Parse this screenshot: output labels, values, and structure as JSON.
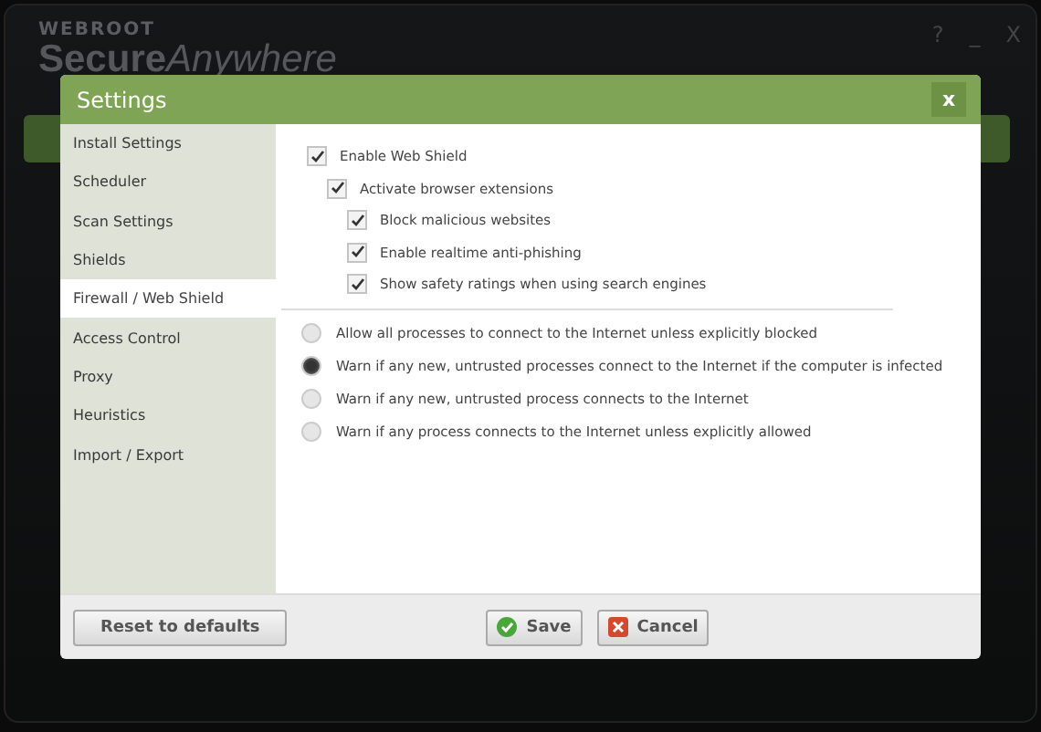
{
  "app": {
    "brand_top": "WEBROOT",
    "brand_main": "Secure",
    "brand_light": "Anywhere",
    "controls": [
      "?",
      "_",
      "X"
    ]
  },
  "dialog": {
    "title": "Settings",
    "close": "x",
    "sidebar": [
      {
        "label": "Install Settings",
        "selected": false
      },
      {
        "label": "Scheduler",
        "selected": false
      },
      {
        "label": "Scan Settings",
        "selected": false
      },
      {
        "label": "Shields",
        "selected": false
      },
      {
        "label": "Firewall / Web Shield",
        "selected": true
      },
      {
        "label": "Access Control",
        "selected": false
      },
      {
        "label": "Proxy",
        "selected": false
      },
      {
        "label": "Heuristics",
        "selected": false
      },
      {
        "label": "Import / Export",
        "selected": false
      }
    ],
    "options": [
      {
        "label": "Enable Web Shield",
        "checked": true,
        "children": [
          {
            "label": "Activate browser extensions",
            "checked": true,
            "children": [
              {
                "label": "Block malicious websites",
                "checked": true
              },
              {
                "label": "Enable realtime anti-phishing",
                "checked": true
              },
              {
                "label": "Show safety ratings when using search engines",
                "checked": true
              }
            ]
          }
        ]
      }
    ],
    "radios": [
      {
        "label": "Allow all processes to connect to the Internet unless explicitly blocked",
        "selected": false
      },
      {
        "label": "Warn if any new, untrusted processes connect to the Internet if the computer is infected",
        "selected": true
      },
      {
        "label": "Warn if any new, untrusted process connects to the Internet",
        "selected": false
      },
      {
        "label": "Warn if any process connects to the Internet unless explicitly allowed",
        "selected": false
      }
    ],
    "buttons": [
      {
        "kind": "reset",
        "label": "Reset to defaults"
      },
      {
        "kind": "save",
        "label": "Save"
      },
      {
        "kind": "cancel",
        "label": "Cancel"
      }
    ]
  }
}
